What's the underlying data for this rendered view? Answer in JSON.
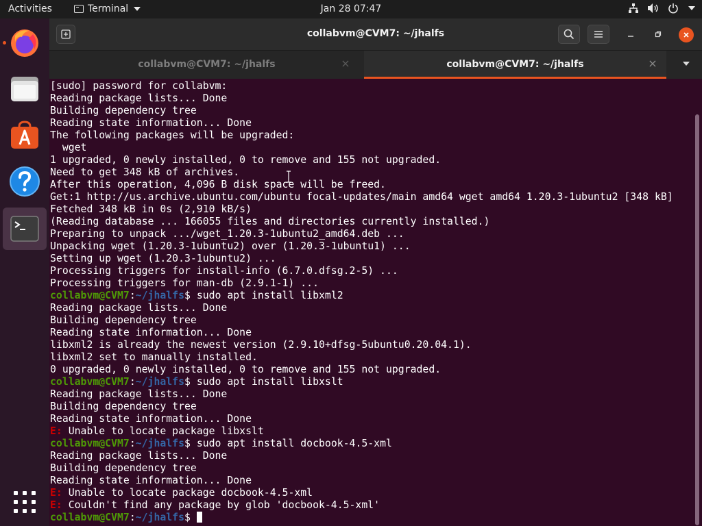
{
  "topbar": {
    "activities": "Activities",
    "app_menu": "Terminal",
    "clock": "Jan 28  07:47",
    "tray_icons": [
      "network-icon",
      "volume-icon",
      "power-icon"
    ]
  },
  "dock": {
    "items": [
      "firefox-icon",
      "files-icon",
      "software-icon",
      "help-icon",
      "terminal-icon"
    ],
    "show_apps": "show-applications-icon"
  },
  "window": {
    "title": "collabvm@CVM7: ~/jhalfs",
    "tabs": [
      {
        "label": "collabvm@CVM7: ~/jhalfs",
        "active": false
      },
      {
        "label": "collabvm@CVM7: ~/jhalfs",
        "active": true
      }
    ]
  },
  "terminal": {
    "lines": [
      [
        {
          "t": "[sudo] password for collabvm:",
          "c": ""
        }
      ],
      [
        {
          "t": "Reading package lists... Done",
          "c": ""
        }
      ],
      [
        {
          "t": "Building dependency tree",
          "c": ""
        }
      ],
      [
        {
          "t": "Reading state information... Done",
          "c": ""
        }
      ],
      [
        {
          "t": "The following packages will be upgraded:",
          "c": ""
        }
      ],
      [
        {
          "t": "  wget",
          "c": ""
        }
      ],
      [
        {
          "t": "1 upgraded, 0 newly installed, 0 to remove and 155 not upgraded.",
          "c": ""
        }
      ],
      [
        {
          "t": "Need to get 348 kB of archives.",
          "c": ""
        }
      ],
      [
        {
          "t": "After this operation, 4,096 B disk space will be freed.",
          "c": ""
        }
      ],
      [
        {
          "t": "Get:1 http://us.archive.ubuntu.com/ubuntu focal-updates/main amd64 wget amd64 1.20.3-1ubuntu2 [348 kB]",
          "c": ""
        }
      ],
      [
        {
          "t": "Fetched 348 kB in 0s (2,910 kB/s)",
          "c": ""
        }
      ],
      [
        {
          "t": "(Reading database ... 166055 files and directories currently installed.)",
          "c": ""
        }
      ],
      [
        {
          "t": "Preparing to unpack .../wget_1.20.3-1ubuntu2_amd64.deb ...",
          "c": ""
        }
      ],
      [
        {
          "t": "Unpacking wget (1.20.3-1ubuntu2) over (1.20.3-1ubuntu1) ...",
          "c": ""
        }
      ],
      [
        {
          "t": "Setting up wget (1.20.3-1ubuntu2) ...",
          "c": ""
        }
      ],
      [
        {
          "t": "Processing triggers for install-info (6.7.0.dfsg.2-5) ...",
          "c": ""
        }
      ],
      [
        {
          "t": "Processing triggers for man-db (2.9.1-1) ...",
          "c": ""
        }
      ],
      [
        {
          "t": "collabvm@CVM7",
          "c": "u"
        },
        {
          "t": ":",
          "c": ""
        },
        {
          "t": "~/jhalfs",
          "c": "p"
        },
        {
          "t": "$ sudo apt install libxml2",
          "c": ""
        }
      ],
      [
        {
          "t": "Reading package lists... Done",
          "c": ""
        }
      ],
      [
        {
          "t": "Building dependency tree",
          "c": ""
        }
      ],
      [
        {
          "t": "Reading state information... Done",
          "c": ""
        }
      ],
      [
        {
          "t": "libxml2 is already the newest version (2.9.10+dfsg-5ubuntu0.20.04.1).",
          "c": ""
        }
      ],
      [
        {
          "t": "libxml2 set to manually installed.",
          "c": ""
        }
      ],
      [
        {
          "t": "0 upgraded, 0 newly installed, 0 to remove and 155 not upgraded.",
          "c": ""
        }
      ],
      [
        {
          "t": "collabvm@CVM7",
          "c": "u"
        },
        {
          "t": ":",
          "c": ""
        },
        {
          "t": "~/jhalfs",
          "c": "p"
        },
        {
          "t": "$ sudo apt install libxslt",
          "c": ""
        }
      ],
      [
        {
          "t": "Reading package lists... Done",
          "c": ""
        }
      ],
      [
        {
          "t": "Building dependency tree",
          "c": ""
        }
      ],
      [
        {
          "t": "Reading state information... Done",
          "c": ""
        }
      ],
      [
        {
          "t": "E:",
          "c": "e"
        },
        {
          "t": " Unable to locate package libxslt",
          "c": ""
        }
      ],
      [
        {
          "t": "collabvm@CVM7",
          "c": "u"
        },
        {
          "t": ":",
          "c": ""
        },
        {
          "t": "~/jhalfs",
          "c": "p"
        },
        {
          "t": "$ sudo apt install docbook-4.5-xml",
          "c": ""
        }
      ],
      [
        {
          "t": "Reading package lists... Done",
          "c": ""
        }
      ],
      [
        {
          "t": "Building dependency tree",
          "c": ""
        }
      ],
      [
        {
          "t": "Reading state information... Done",
          "c": ""
        }
      ],
      [
        {
          "t": "E:",
          "c": "e"
        },
        {
          "t": " Unable to locate package docbook-4.5-xml",
          "c": ""
        }
      ],
      [
        {
          "t": "E:",
          "c": "e"
        },
        {
          "t": " Couldn't find any package by glob 'docbook-4.5-xml'",
          "c": ""
        }
      ],
      [
        {
          "t": "collabvm@CVM7",
          "c": "u"
        },
        {
          "t": ":",
          "c": ""
        },
        {
          "t": "~/jhalfs",
          "c": "p"
        },
        {
          "t": "$ ",
          "c": ""
        }
      ]
    ]
  },
  "colors": {
    "background": "#300a24",
    "user_host": "#4e9a06",
    "path": "#3465a4",
    "error": "#cc0000",
    "accent": "#e95420"
  }
}
